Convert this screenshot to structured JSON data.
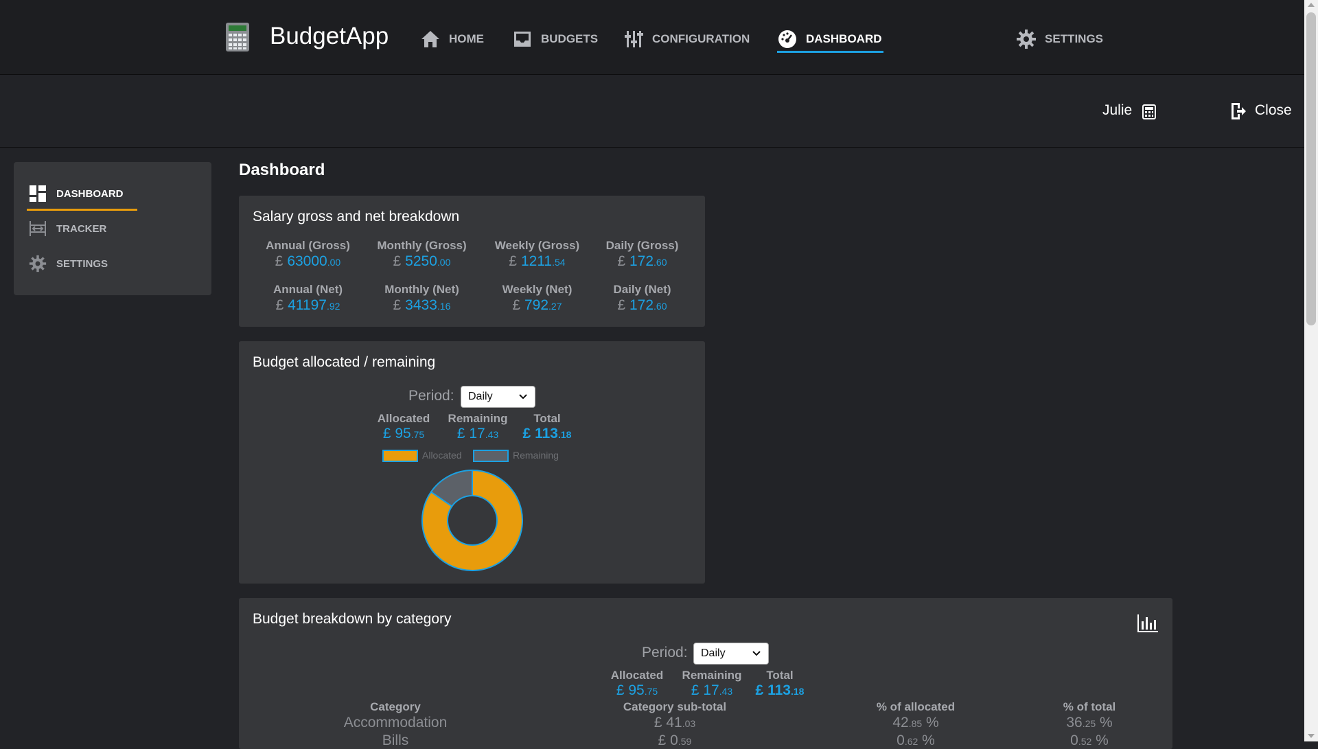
{
  "app": {
    "name": "BudgetApp"
  },
  "nav": {
    "items": [
      {
        "label": "HOME",
        "icon": "home-icon"
      },
      {
        "label": "BUDGETS",
        "icon": "inbox-icon"
      },
      {
        "label": "CONFIGURATION",
        "icon": "sliders-icon"
      },
      {
        "label": "DASHBOARD",
        "icon": "gauge-icon",
        "active": true
      },
      {
        "label": "SETTINGS",
        "icon": "gear-icon"
      }
    ]
  },
  "header": {
    "user": "Julie",
    "close_label": "Close"
  },
  "sidebar": {
    "items": [
      {
        "label": "DASHBOARD",
        "icon": "dashboard-icon",
        "active": true
      },
      {
        "label": "TRACKER",
        "icon": "tracker-icon"
      },
      {
        "label": "SETTINGS",
        "icon": "gear-icon"
      }
    ]
  },
  "page": {
    "title": "Dashboard"
  },
  "salary": {
    "title": "Salary gross and net breakdown",
    "currency": "£",
    "gross": [
      {
        "label": "Annual (Gross)",
        "int": "63000",
        "dec": ".00"
      },
      {
        "label": "Monthly (Gross)",
        "int": "5250",
        "dec": ".00"
      },
      {
        "label": "Weekly (Gross)",
        "int": "1211",
        "dec": ".54"
      },
      {
        "label": "Daily (Gross)",
        "int": "172",
        "dec": ".60"
      }
    ],
    "net": [
      {
        "label": "Annual (Net)",
        "int": "41197",
        "dec": ".92"
      },
      {
        "label": "Monthly (Net)",
        "int": "3433",
        "dec": ".16"
      },
      {
        "label": "Weekly (Net)",
        "int": "792",
        "dec": ".27"
      },
      {
        "label": "Daily (Net)",
        "int": "172",
        "dec": ".60"
      }
    ]
  },
  "budget": {
    "title": "Budget allocated / remaining",
    "period_label": "Period:",
    "period_value": "Daily",
    "allocated_label": "Allocated",
    "allocated": {
      "cur": "£",
      "int": "95",
      "dec": ".75"
    },
    "remaining_label": "Remaining",
    "remaining": {
      "cur": "£",
      "int": "17",
      "dec": ".43"
    },
    "total_label": "Total",
    "total": {
      "cur": "£",
      "int": "113",
      "dec": ".18"
    },
    "colors": {
      "allocated": "#e89c0c",
      "remaining": "#5c6168",
      "border": "#1ca1e2"
    }
  },
  "chart_data": {
    "type": "pie",
    "categories": [
      "Allocated",
      "Remaining"
    ],
    "values": [
      95.75,
      17.43
    ],
    "colors": [
      "#e89c0c",
      "#5c6168"
    ],
    "legend": "top"
  },
  "breakdown": {
    "title": "Budget breakdown by category",
    "chart_icon": "bar-chart-icon",
    "period_label": "Period:",
    "period_value": "Daily",
    "allocated_label": "Allocated",
    "allocated": {
      "cur": "£",
      "int": "95",
      "dec": ".75"
    },
    "remaining_label": "Remaining",
    "remaining": {
      "cur": "£",
      "int": "17",
      "dec": ".43"
    },
    "total_label": "Total",
    "total": {
      "cur": "£",
      "int": "113",
      "dec": ".18"
    },
    "columns": [
      "Category",
      "Category sub-total",
      "% of allocated",
      "% of total"
    ],
    "rows": [
      {
        "category": "Accommodation",
        "subtotal_int": "£ 41",
        "subtotal_dec": ".03",
        "pct_alloc_int": "42",
        "pct_alloc_dec": ".85",
        "pct_total_int": "36",
        "pct_total_dec": ".25"
      },
      {
        "category": "Bills",
        "subtotal_int": "£ 0",
        "subtotal_dec": ".59",
        "pct_alloc_int": "0",
        "pct_alloc_dec": ".62",
        "pct_total_int": "0",
        "pct_total_dec": ".52"
      }
    ]
  }
}
